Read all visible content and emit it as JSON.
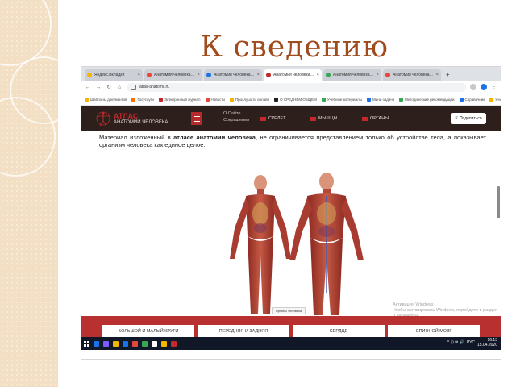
{
  "slide": {
    "title": "К сведению"
  },
  "browser": {
    "tabs": [
      {
        "label": "Яндекс.Вкладки",
        "color": "#f4b400",
        "active": false
      },
      {
        "label": "Анатомия человека. Атлас",
        "color": "#e8453c",
        "active": false
      },
      {
        "label": "Анатомия человека. Атлас",
        "color": "#1a73e8",
        "active": false
      },
      {
        "label": "Анатомия человека. Атлас",
        "color": "#c3282d",
        "active": true
      },
      {
        "label": "Анатомия человека. Атлас",
        "color": "#34a853",
        "active": false
      },
      {
        "label": "Анатомия человека. Атлас",
        "color": "#e8453c",
        "active": false
      }
    ],
    "new_tab_label": "+",
    "url": "atlas-anatomii.ru",
    "bookmarks": [
      {
        "label": "Шаблоны документов",
        "color": "#f4b400"
      },
      {
        "label": "Госуслуги",
        "color": "#ff6d00"
      },
      {
        "label": "Электронный журнал",
        "color": "#c3282d"
      },
      {
        "label": "Новости",
        "color": "#e8453c"
      },
      {
        "label": "Прослушать онлайн",
        "color": "#f4b400"
      },
      {
        "label": "О СРЕДНЕМ ОБЩЕМ",
        "color": "#202124"
      },
      {
        "label": "Учебные материалы",
        "color": "#34a853"
      },
      {
        "label": "Мини-задачи",
        "color": "#1a73e8"
      },
      {
        "label": "Методические рекомендации",
        "color": "#34a853"
      },
      {
        "label": "Справочник",
        "color": "#1a73e8"
      },
      {
        "label": "Учительская",
        "color": "#f4b400"
      }
    ]
  },
  "site": {
    "logo_title": "АТЛАС",
    "logo_sub": "АНАТОМИИ ЧЕЛОВЕКА",
    "about": [
      "О Сайте",
      "Сокращения"
    ],
    "nav": [
      {
        "label": "СКЕЛЕТ"
      },
      {
        "label": "МЫШЦЫ"
      },
      {
        "label": "ОРГАНЫ"
      }
    ],
    "share_label": "Поделиться",
    "intro_before": "Материал изложенный в ",
    "intro_bold": "атласе анатомии человека",
    "intro_after": ", не ограничивается представлением только об устройстве тела, а показывает организм человека как единое целое.",
    "caption": "Органы человека",
    "watermark": {
      "line1": "Активация Windows",
      "line2": "Чтобы активировать Windows, перейдите в раздел",
      "line3": "\"Параметры\"."
    },
    "cards": [
      {
        "label": "БОЛЬШОЙ И МАЛЫЙ КРУГИ"
      },
      {
        "label": "ПЕРЕДНЯЯ И ЗАДНЯЯ"
      },
      {
        "label": "СЕРДЦЕ"
      },
      {
        "label": "СПИННОЙ МОЗГ"
      }
    ]
  },
  "taskbar": {
    "apps": [
      "#1a73e8",
      "#7b5cff",
      "#f4b400",
      "#1a73e8",
      "#e8453c",
      "#34a853",
      "#ffffff",
      "#f4b400",
      "#c3282d"
    ],
    "tray_text": "^ ⊡ ✉ 🔊",
    "lang": "РУС",
    "time": "16:13",
    "date": "15.04.2020"
  }
}
